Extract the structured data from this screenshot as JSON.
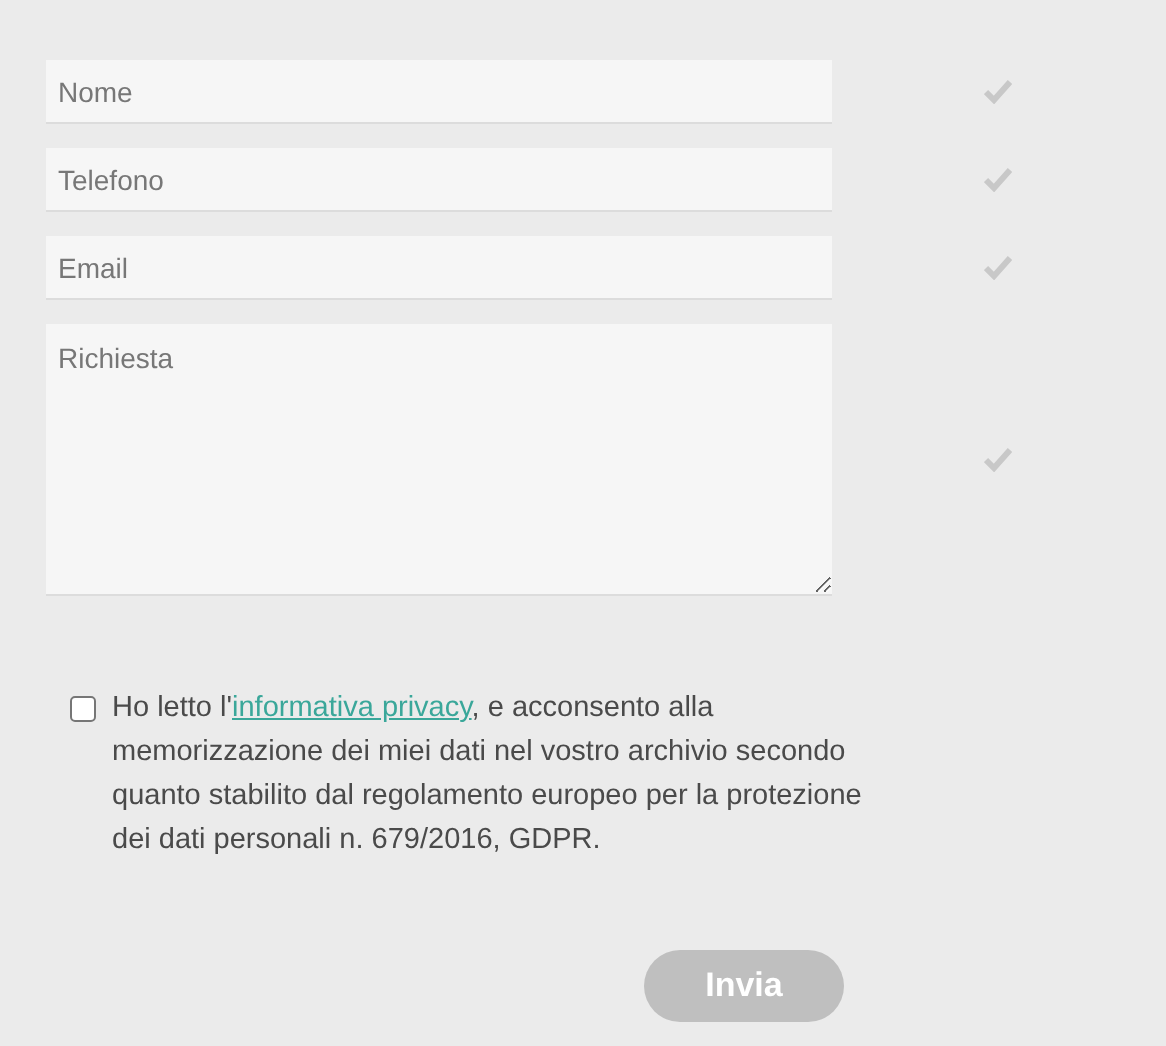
{
  "fields": [
    {
      "kind": "input",
      "placeholder": "Nome"
    },
    {
      "kind": "input",
      "placeholder": "Telefono"
    },
    {
      "kind": "input",
      "placeholder": "Email"
    },
    {
      "kind": "textarea",
      "placeholder": "Richiesta"
    }
  ],
  "consent": {
    "checked": false,
    "before": "Ho letto l'",
    "link": "informativa privacy",
    "after": ", e acconsento alla memorizzazione dei miei dati nel vostro archivio secondo quanto stabilito dal regolamento europeo per la protezione dei dati personali n. 679/2016, GDPR."
  },
  "submit": {
    "label": "Invia",
    "disabled": true
  }
}
